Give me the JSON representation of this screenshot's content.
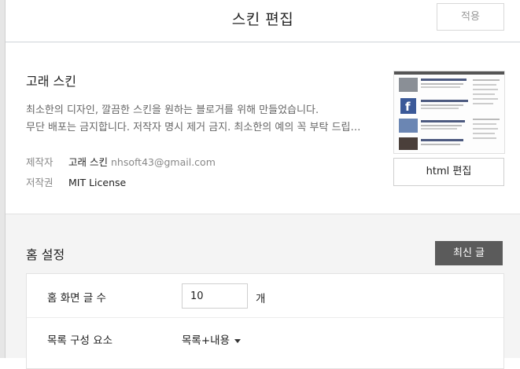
{
  "header": {
    "title": "스킨 편집",
    "apply_label": "적용"
  },
  "skin": {
    "name": "고래 스킨",
    "description_lines": [
      "최소한의 디자인, 깔끔한 스킨을 원하는 블로거를 위해 만들었습니다.",
      "무단 배포는 금지합니다. 저작자 명시 제거 금지. 최소한의 예의 꼭 부탁 드립…"
    ],
    "author_label": "제작자",
    "author_name": "고래 스킨",
    "author_email": "nhsoft43@gmail.com",
    "license_label": "저작권",
    "license_value": "MIT License",
    "html_edit_label": "html 편집"
  },
  "home": {
    "title": "홈 설정",
    "latest_button": "최신 글",
    "post_count_label": "홈 화면 글 수",
    "post_count_value": "10",
    "post_count_unit": "개",
    "list_element_label": "목록 구성 요소",
    "list_element_value": "목록+내용"
  }
}
